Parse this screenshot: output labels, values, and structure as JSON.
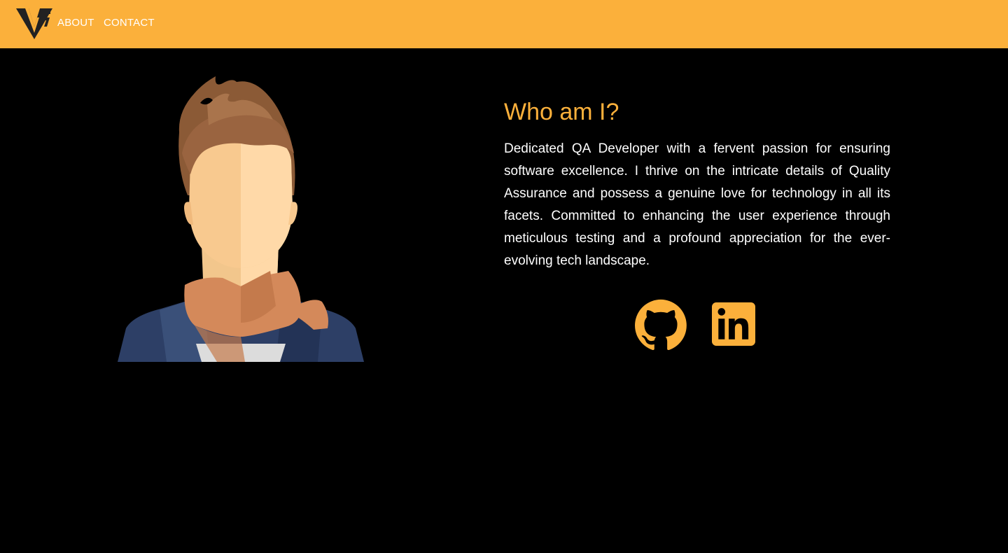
{
  "nav": {
    "logo_icon": "vs-monogram-logo-icon",
    "items": [
      {
        "label": "ABOUT"
      },
      {
        "label": "CONTACT"
      }
    ]
  },
  "about": {
    "title": "Who am I?",
    "body": "Dedicated QA Developer with a fervent passion for ensuring software excellence. I thrive on the intricate details of Quality Assurance and possess a genuine love for technology in all its facets. Committed to enhancing the user experience through meticulous testing and a profound appreciation for the ever-evolving tech landscape."
  },
  "social": [
    {
      "icon": "github-icon"
    },
    {
      "icon": "linkedin-icon"
    }
  ],
  "colors": {
    "accent": "#fbb03b",
    "background": "#000000",
    "text": "#ffffff"
  }
}
